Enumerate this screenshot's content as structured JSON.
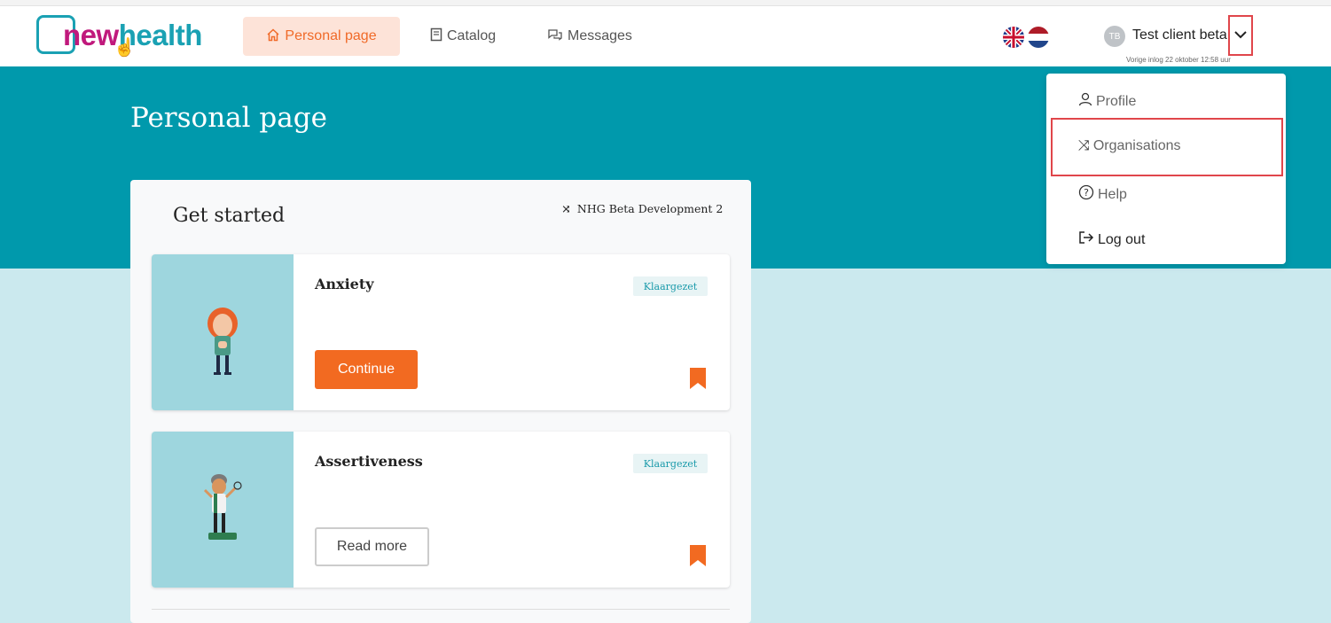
{
  "header": {
    "logo_new": "new",
    "logo_health": "health",
    "nav": {
      "personal_page": "Personal page",
      "catalog": "Catalog",
      "messages": "Messages"
    },
    "user": {
      "initials": "TB",
      "name": "Test client beta",
      "last_login": "Vorige inlog 22 oktober 12:58 uur"
    }
  },
  "hero": {
    "title": "Personal page"
  },
  "panel": {
    "title": "Get started",
    "organisation": "NHG Beta Development 2",
    "cards": [
      {
        "title": "Anxiety",
        "badge": "Klaargezet",
        "button": "Continue"
      },
      {
        "title": "Assertiveness",
        "badge": "Klaargezet",
        "button": "Read more"
      }
    ]
  },
  "dropdown": {
    "profile": "Profile",
    "organisations": "Organisations",
    "help": "Help",
    "logout": "Log out"
  },
  "colors": {
    "brand_teal": "#0099ac",
    "brand_magenta": "#c0197c",
    "accent_orange": "#f26a21",
    "highlight_red": "#e0464b"
  }
}
